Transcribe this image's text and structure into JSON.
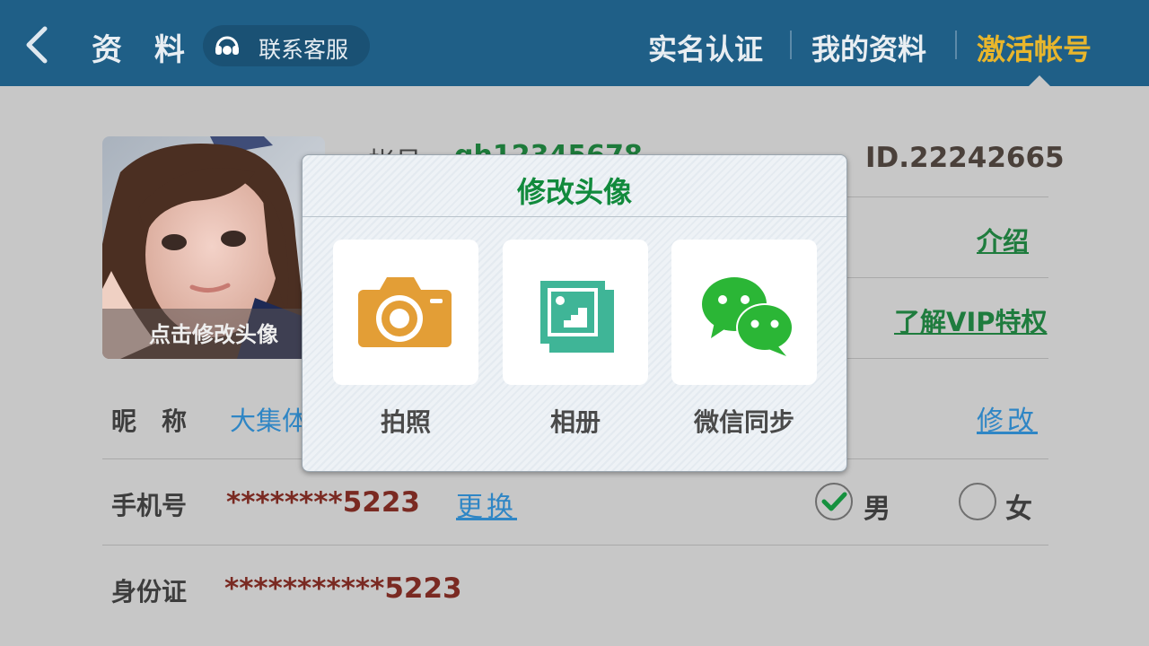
{
  "header": {
    "back_icon": "chevron-left-icon",
    "title": "资 料",
    "service_icon": "headset-icon",
    "service_label": "联系客服",
    "tabs": [
      {
        "label": "实名认证",
        "active": false
      },
      {
        "label": "我的资料",
        "active": false
      },
      {
        "label": "激活帐号",
        "active": true
      }
    ],
    "active_color": "#e8b62c"
  },
  "profile": {
    "avatar_caption": "点击修改头像",
    "account_label": "帐号",
    "account_value": "gh12345678",
    "user_id": "ID.22242665",
    "intro_link": "介绍",
    "vip_link": "了解VIP特权",
    "nickname_label": "昵　称",
    "nickname_value": "大集体",
    "nickname_edit": "修改",
    "phone_label": "手机号",
    "phone_value": "********5223",
    "phone_change": "更换",
    "gender_male": "男",
    "gender_female": "女",
    "gender_selected": "男",
    "idcard_label": "身份证",
    "idcard_value": "***********5223"
  },
  "modal": {
    "title": "修改头像",
    "options": [
      {
        "label": "拍照",
        "icon": "camera-icon",
        "color": "#e39e36"
      },
      {
        "label": "相册",
        "icon": "photo-album-icon",
        "color": "#3fb597"
      },
      {
        "label": "微信同步",
        "icon": "wechat-icon",
        "color": "#2bb636"
      }
    ]
  }
}
